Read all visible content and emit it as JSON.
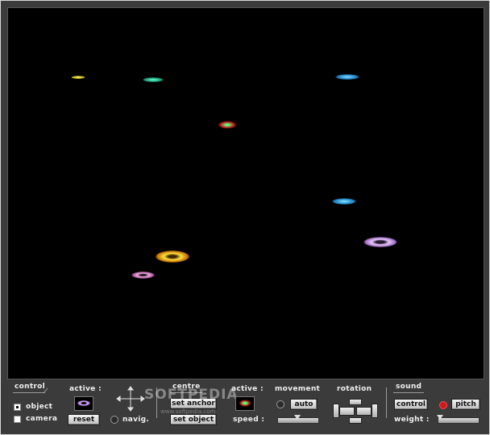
{
  "viewport": {
    "objects": [
      {
        "name": "ring-yellow-small",
        "color": "#c8c020"
      },
      {
        "name": "ring-teal",
        "color": "#20a888"
      },
      {
        "name": "ring-blue-top-right",
        "color": "#2088c8"
      },
      {
        "name": "ring-red-green-center",
        "color": "#d02020"
      },
      {
        "name": "ring-blue-middle",
        "color": "#2090d0"
      },
      {
        "name": "ring-violet-large",
        "color": "#c090e0"
      },
      {
        "name": "ring-yellow-orange",
        "color": "#e0b000"
      },
      {
        "name": "ring-magenta-small",
        "color": "#c070b0"
      }
    ]
  },
  "controls": {
    "control_label": "control",
    "object_label": "object",
    "camera_label": "camera",
    "object_checked": true,
    "camera_checked": false,
    "active_label": "active :",
    "reset_label": "reset",
    "navig_label": "navig."
  },
  "centre": {
    "title": "centre",
    "set_anchor_label": "set anchor",
    "set_object_label": "set object",
    "active_label": "active :",
    "speed_label": "speed :"
  },
  "movement": {
    "title": "movement",
    "auto_label": "auto"
  },
  "rotation": {
    "title": "rotation"
  },
  "sound": {
    "title": "sound",
    "control_label": "control",
    "pitch_label": "pitch",
    "weight_label": "weight :"
  },
  "watermark": {
    "text": "SOFTPEDIA",
    "url": "www.softpedia.com"
  },
  "icons": [
    "navigation-cross-icon",
    "active-object-ring-icon",
    "active-speed-ring-icon",
    "rotation-pad-icon"
  ]
}
